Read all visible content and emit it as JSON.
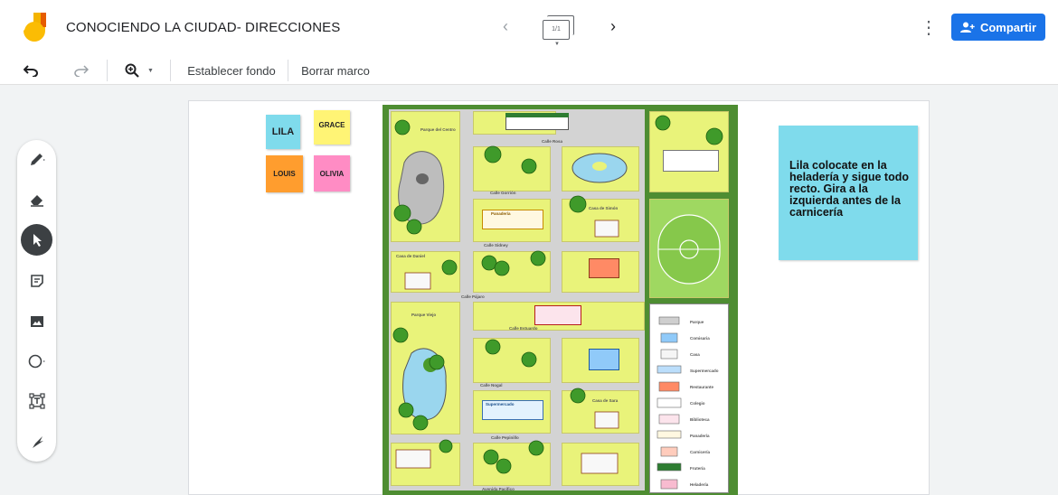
{
  "header": {
    "title": "CONOCIENDO LA CIUDAD- DIRECCIONES",
    "frame_indicator": "1/1",
    "share_label": "Compartir",
    "colors": {
      "accent": "#1a73e8"
    }
  },
  "toolbar": {
    "background_label": "Establecer fondo",
    "clear_label": "Borrar marco"
  },
  "tools": [
    "pen-icon",
    "eraser-icon",
    "select-icon",
    "sticky-note-icon",
    "image-icon",
    "circle-icon",
    "text-box-icon",
    "laser-icon"
  ],
  "canvas": {
    "stickies": [
      {
        "label": "LILA",
        "color": "#7fdbec"
      },
      {
        "label": "GRACE",
        "color": "#fff475"
      },
      {
        "label": "LOUIS",
        "color": "#ff9d2e"
      },
      {
        "label": "OLIVIA",
        "color": "#ff8cc4"
      }
    ],
    "note": "Lila colocate en la heladería y sigue todo recto. Gira a la izquierda antes de la carnicería"
  },
  "map": {
    "streets": {
      "calle_rosa": "Calle Rosa",
      "calle_gorrion": "Calle Gorrión",
      "calle_sidney": "Calle Sidney",
      "calle_pajaro": "Calle Pájaro",
      "calle_estuardo": "Calle Estuardo",
      "calle_nogal": "Calle Nogal",
      "calle_pepinillo": "Calle Pepinillo",
      "avenida_pacifico": "Avenida Pacífico"
    },
    "places": {
      "parque_centro": "Parque del Centro",
      "parque_viejo": "Parque Viejo",
      "casa_daniel": "Casa de Daniel",
      "casa_simon": "Casa de Simón",
      "casa_sara": "Casa de Sara",
      "frutería": "Frutería",
      "panaderia": "Panadería",
      "supermercado": "Supermercado"
    },
    "legend": [
      "Parque",
      "Comisaria",
      "Casa",
      "Supermercado",
      "Restaurante",
      "Colegio",
      "Biblioteca",
      "Panadería",
      "Carnicería",
      "Frutería",
      "Heladería"
    ]
  }
}
